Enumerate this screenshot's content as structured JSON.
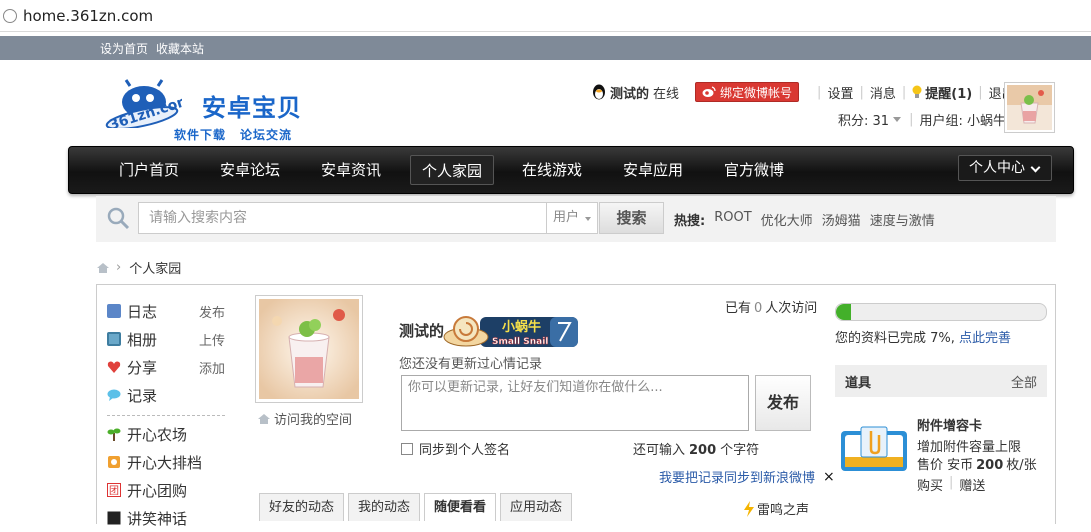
{
  "browser": {
    "url": "home.361zn.com"
  },
  "topbar": {
    "set_home": "设为首页",
    "bookmark": "收藏本站"
  },
  "logo": {
    "brand": "安卓宝贝",
    "domain": "361zn.com",
    "sub1": "软件下载",
    "sub2": "论坛交流"
  },
  "user": {
    "name": "测试的",
    "online": "在线",
    "bind_weibo": "绑定微博帐号",
    "settings": "设置",
    "messages": "消息",
    "remind": "提醒(1)",
    "logout": "退出",
    "points_label": "积分: 31",
    "group": "用户组: 小蜗牛"
  },
  "nav": {
    "items": [
      "门户首页",
      "安卓论坛",
      "安卓资讯",
      "个人家园",
      "在线游戏",
      "安卓应用",
      "官方微博"
    ],
    "active": "个人家园",
    "personal_center": "个人中心"
  },
  "search": {
    "placeholder": "请输入搜索内容",
    "type": "用户",
    "button": "搜索",
    "hot_label": "热搜:",
    "hot": [
      "ROOT",
      "优化大师",
      "汤姆猫",
      "速度与激情"
    ]
  },
  "breadcrumb": {
    "current": "个人家园"
  },
  "leftnav": {
    "items": [
      {
        "label": "日志",
        "action": "发布"
      },
      {
        "label": "相册",
        "action": "上传"
      },
      {
        "label": "分享",
        "action": "添加"
      },
      {
        "label": "记录",
        "action": ""
      }
    ],
    "apps": [
      "开心农场",
      "开心大排档",
      "开心团购",
      "讲笑神话"
    ]
  },
  "profile": {
    "visit_space": "访问我的空间",
    "name": "测试的",
    "snail_cn": "小蜗牛",
    "snail_en": "Small Snail",
    "visits_prefix": "已有",
    "visits": "0",
    "visits_suffix": "人次访问",
    "status_label": "您还没有更新过心情记录",
    "status_placeholder": "你可以更新记录, 让好友们知道你在做什么...",
    "publish": "发布",
    "sync_signature": "同步到个人签名",
    "remain_prefix": "还可输入",
    "remain": "200",
    "remain_suffix": "个字符",
    "sync_weibo": "我要把记录同步到新浪微博",
    "close": "×"
  },
  "tabs": {
    "items": [
      "好友的动态",
      "我的动态",
      "随便看看",
      "应用动态"
    ],
    "active": "随便看看"
  },
  "thunder": "雷鸣之声",
  "completion": {
    "percent": 7,
    "text": "您的资料已完成 7%, ",
    "link": "点此完善"
  },
  "tools": {
    "title": "道具",
    "all": "全部",
    "item_name": "附件增容卡",
    "item_desc": "增加附件容量上限",
    "price_prefix": "售价 安币",
    "price": "200",
    "price_suffix": "枚/张",
    "buy": "购买",
    "gift": "赠送"
  },
  "colors": {
    "accent": "#1a66c9",
    "link": "#2b5ba8",
    "weibo": "#d93832",
    "progress": "#43b02a"
  }
}
